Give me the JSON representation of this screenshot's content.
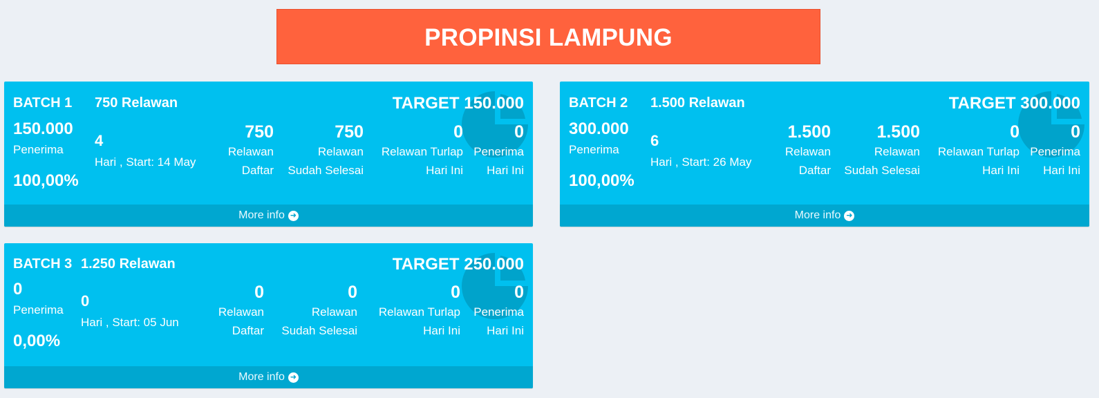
{
  "header": {
    "title": "PROPINSI LAMPUNG"
  },
  "boxes": [
    {
      "batch": "BATCH 1",
      "relawan": "750 Relawan",
      "target": "TARGET 150.000",
      "penerima_count": "150.000",
      "penerima_label": "Penerima",
      "percent": "100,00%",
      "days": "4",
      "days_label": "Hari , Start: 14 May",
      "stats": [
        {
          "value": "750",
          "line1": "Relawan",
          "line2": "Daftar"
        },
        {
          "value": "750",
          "line1": "Relawan",
          "line2": "Sudah Selesai"
        },
        {
          "value": "0",
          "line1": "Relawan Turlap",
          "line2": "Hari Ini"
        },
        {
          "value": "0",
          "line1": "Penerima",
          "line2": "Hari Ini"
        }
      ],
      "more_info": "More info",
      "icon": "pie-chart-icon"
    },
    {
      "batch": "BATCH 2",
      "relawan": "1.500 Relawan",
      "target": "TARGET 300.000",
      "penerima_count": "300.000",
      "penerima_label": "Penerima",
      "percent": "100,00%",
      "days": "6",
      "days_label": "Hari , Start: 26 May",
      "stats": [
        {
          "value": "1.500",
          "line1": "Relawan",
          "line2": "Daftar"
        },
        {
          "value": "1.500",
          "line1": "Relawan",
          "line2": "Sudah Selesai"
        },
        {
          "value": "0",
          "line1": "Relawan Turlap",
          "line2": "Hari Ini"
        },
        {
          "value": "0",
          "line1": "Penerima",
          "line2": "Hari Ini"
        }
      ],
      "more_info": "More info",
      "icon": "pie-chart-icon"
    },
    {
      "batch": "BATCH 3",
      "relawan": "1.250 Relawan",
      "target": "TARGET 250.000",
      "penerima_count": "0",
      "penerima_label": "Penerima",
      "percent": "0,00%",
      "days": "0",
      "days_label": "Hari , Start: 05 Jun",
      "stats": [
        {
          "value": "0",
          "line1": "Relawan",
          "line2": "Daftar"
        },
        {
          "value": "0",
          "line1": "Relawan",
          "line2": "Sudah Selesai"
        },
        {
          "value": "0",
          "line1": "Relawan Turlap",
          "line2": "Hari Ini"
        },
        {
          "value": "0",
          "line1": "Penerima",
          "line2": "Hari Ini"
        }
      ],
      "more_info": "More info",
      "icon": "pie-chart-icon"
    }
  ],
  "colors": {
    "banner": "#ff623d",
    "box": "#00c0ef",
    "footer": "#00a7d0",
    "background": "#ecf0f5"
  }
}
